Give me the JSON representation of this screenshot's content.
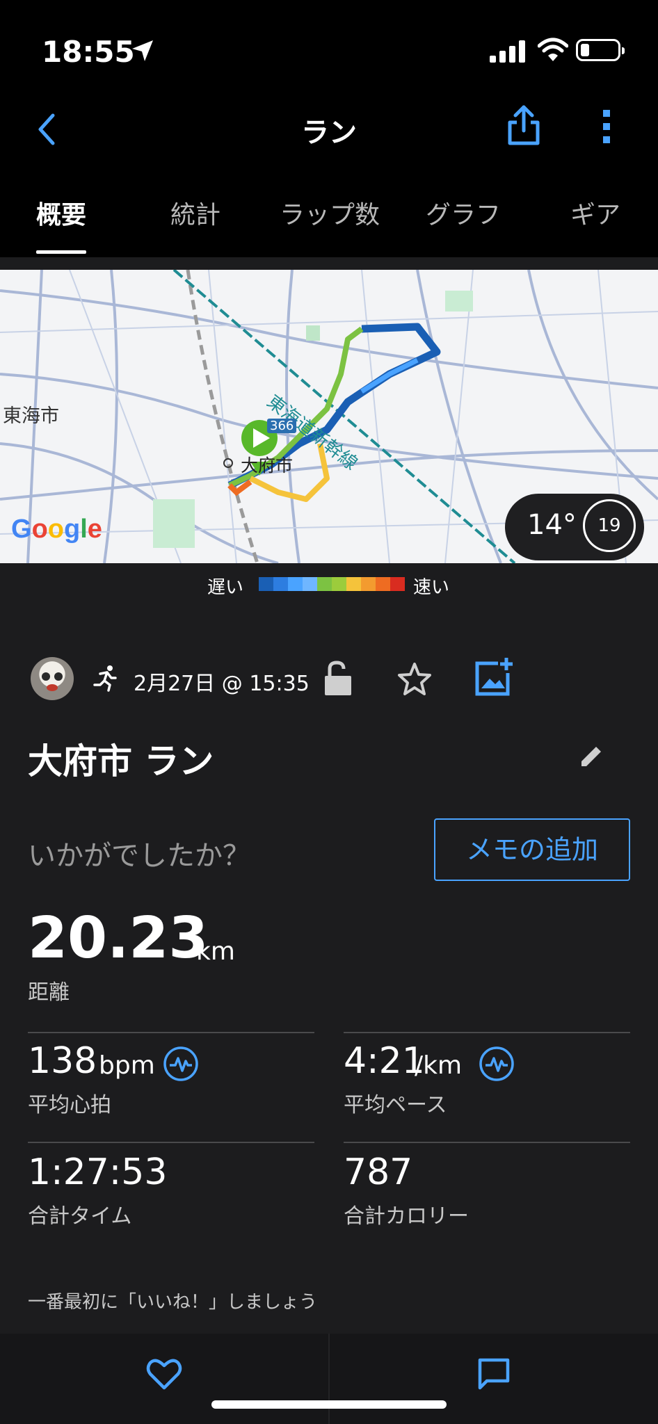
{
  "status_bar": {
    "time": "18:55"
  },
  "header": {
    "title": "ラン"
  },
  "tabs": [
    {
      "label": "概要"
    },
    {
      "label": "統計"
    },
    {
      "label": "ラップ数"
    },
    {
      "label": "グラフ"
    },
    {
      "label": "ギア"
    }
  ],
  "map": {
    "place_label_left": "東海市",
    "place_label_city": "大府市",
    "railway_label": "東海道新幹線",
    "road_shield": "366",
    "google_logo": "Google",
    "temperature": "14°",
    "clock_value": "19"
  },
  "legend": {
    "slow": "遅い",
    "fast": "速い",
    "colors": [
      "#1a5fb4",
      "#2d7de0",
      "#4aa3ff",
      "#6fb6ff",
      "#7cc242",
      "#9ccc3c",
      "#f5c33b",
      "#f39b2f",
      "#ee6c22",
      "#d92c20"
    ]
  },
  "activity": {
    "date": "2月27日 @ 15:35",
    "title": "大府市 ラン",
    "how_prompt": "いかがでしたか？",
    "memo_button": "メモの追加"
  },
  "stats": {
    "distance": {
      "value": "20.23",
      "unit": "km",
      "label": "距離"
    },
    "avg_hr": {
      "value": "138",
      "unit": "bpm",
      "label": "平均心拍"
    },
    "avg_pace": {
      "value": "4:21",
      "unit": "/km",
      "label": "平均ペース"
    },
    "total_time": {
      "value": "1:27:53",
      "label": "合計タイム"
    },
    "calories": {
      "value": "787",
      "label": "合計カロリー"
    }
  },
  "like_prompt": "一番最初に「いいね！」しましょう",
  "accent_color": "#4aa3ff"
}
